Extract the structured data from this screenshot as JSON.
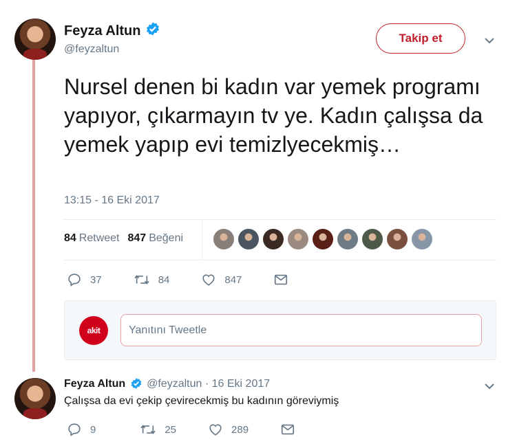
{
  "main_tweet": {
    "author_name": "Feyza Altun",
    "handle": "@feyzaltun",
    "follow_label": "Takip et",
    "text": "Nursel denen bi kadın var yemek programı yapıyor, çıkarmayın tv ye. Kadın çalışsa da yemek yapıp evi temizlyecekmiş…",
    "timestamp": "13:15 - 16 Eki 2017",
    "retweet_count": "84",
    "retweet_label": "Retweet",
    "like_count": "847",
    "like_label": "Beğeni",
    "actions": {
      "replies": "37",
      "retweets": "84",
      "likes": "847"
    }
  },
  "liker_avatars": [
    "#8a7f78",
    "#4b5560",
    "#3a2a22",
    "#9a8a80",
    "#5a2018",
    "#6e7b84",
    "#4e5a48",
    "#7a5040",
    "#8696a6"
  ],
  "reply_box": {
    "avatar_text": "akit",
    "placeholder": "Yanıtını Tweetle"
  },
  "thread_reply": {
    "author_name": "Feyza Altun",
    "handle": "@feyzaltun",
    "separator": "·",
    "date": "16 Eki 2017",
    "text": "Çalışsa da evi çekip çevirecekmiş bu kadının göreviymiş",
    "actions": {
      "replies": "9",
      "retweets": "25",
      "likes": "289"
    }
  },
  "colors": {
    "accent": "#c11e2a",
    "thread_line": "#e0a4a4",
    "verified": "#1da1f2",
    "muted": "#657786"
  },
  "icons": [
    "verified-badge-icon",
    "chevron-down-icon",
    "reply-icon",
    "retweet-icon",
    "like-icon",
    "direct-message-icon"
  ]
}
